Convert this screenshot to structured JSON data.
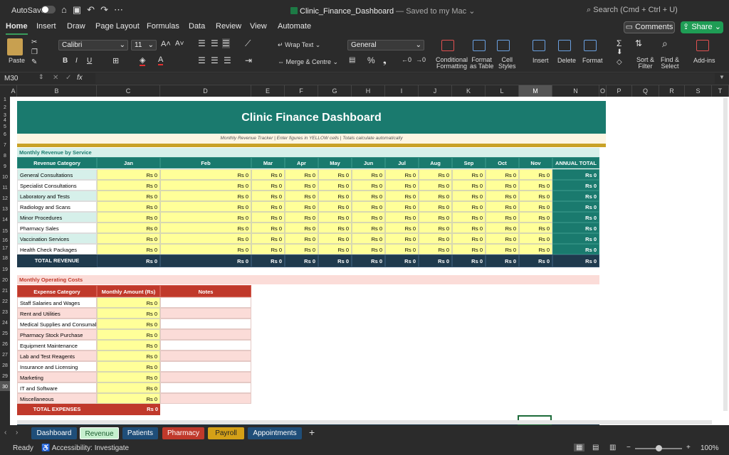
{
  "titlebar": {
    "autosave": "AutoSave",
    "document": "Clinic_Finance_Dashboard",
    "saved": "— Saved to my Mac",
    "search_placeholder": "Search (Cmd + Ctrl + U)"
  },
  "menu": {
    "tabs": [
      "Home",
      "Insert",
      "Draw",
      "Page Layout",
      "Formulas",
      "Data",
      "Review",
      "View",
      "Automate"
    ],
    "comments": "Comments",
    "share": "Share"
  },
  "ribbon": {
    "paste": "Paste",
    "font_name": "Calibri",
    "font_size": "11",
    "wrap_text": "Wrap Text",
    "merge": "Merge & Centre",
    "number_format": "General",
    "conditional": "Conditional",
    "formatting": "Formatting",
    "format_as": "Format",
    "as_table": "as Table",
    "cell": "Cell",
    "styles": "Styles",
    "insert": "Insert",
    "delete": "Delete",
    "format": "Format",
    "sort": "Sort &",
    "filter": "Filter",
    "find": "Find &",
    "select": "Select",
    "addins": "Add-ins"
  },
  "formula": {
    "cell_ref": "M30",
    "fx": "fx"
  },
  "columns": [
    "A",
    "B",
    "C",
    "D",
    "E",
    "F",
    "G",
    "H",
    "I",
    "J",
    "K",
    "L",
    "M",
    "N",
    "O",
    "P",
    "Q",
    "R",
    "S",
    "T"
  ],
  "rows": [
    "1",
    "2",
    "3",
    "4",
    "5",
    "6",
    "7",
    "8",
    "9",
    "10",
    "11",
    "12",
    "13",
    "14",
    "15",
    "16",
    "17",
    "18",
    "19",
    "20",
    "21",
    "22",
    "23",
    "24",
    "25",
    "26",
    "27",
    "28",
    "29",
    "30"
  ],
  "dashboard": {
    "title": "Clinic Finance Dashboard",
    "subtitle": "Monthly Revenue Tracker  |  Enter figures in YELLOW cells  |  Totals calculate automatically",
    "revenue_section": "Monthly Revenue by Service",
    "revenue_headers": [
      "Revenue Category",
      "Jan",
      "Feb",
      "Mar",
      "Apr",
      "May",
      "Jun",
      "Jul",
      "Aug",
      "Sep",
      "Oct",
      "Nov",
      "ANNUAL TOTAL"
    ],
    "revenue_rows": [
      "General Consultations",
      "Specialist Consultations",
      "Laboratory and Tests",
      "Radiology and Scans",
      "Minor Procedures",
      "Pharmacy Sales",
      "Vaccination Services",
      "Health Check Packages"
    ],
    "value": "Rs 0",
    "total_revenue": "TOTAL REVENUE",
    "costs_section": "Monthly Operating Costs",
    "cost_headers": [
      "Expense Category",
      "Monthly Amount (Rs)",
      "Notes"
    ],
    "cost_rows": [
      "Staff Salaries and Wages",
      "Rent and Utilities",
      "Medical Supplies and Consumables",
      "Pharmacy Stock Purchase",
      "Equipment Maintenance",
      "Lab and Test Reagents",
      "Insurance and Licensing",
      "Marketing",
      "IT and Software",
      "Miscellaneous"
    ],
    "total_expenses": "TOTAL EXPENSES"
  },
  "sheet_tabs": [
    "Dashboard",
    "Revenue",
    "Patients",
    "Pharmacy",
    "Payroll",
    "Appointments"
  ],
  "sheet_tab_colors": [
    "#1f4e79",
    "#c6efce",
    "#1f4e79",
    "#c0392b",
    "#d4a017",
    "#1f4e79"
  ],
  "status": {
    "ready": "Ready",
    "accessibility": "Accessibility: Investigate",
    "zoom": "100%"
  },
  "colors": {
    "header_teal": "#1a7a6e",
    "input_yellow": "#ffff99",
    "total_navy": "#1f3a4d",
    "cost_red": "#c0392b",
    "label_mint": "#d6f0ea",
    "label_pink": "#fbdcd8"
  }
}
